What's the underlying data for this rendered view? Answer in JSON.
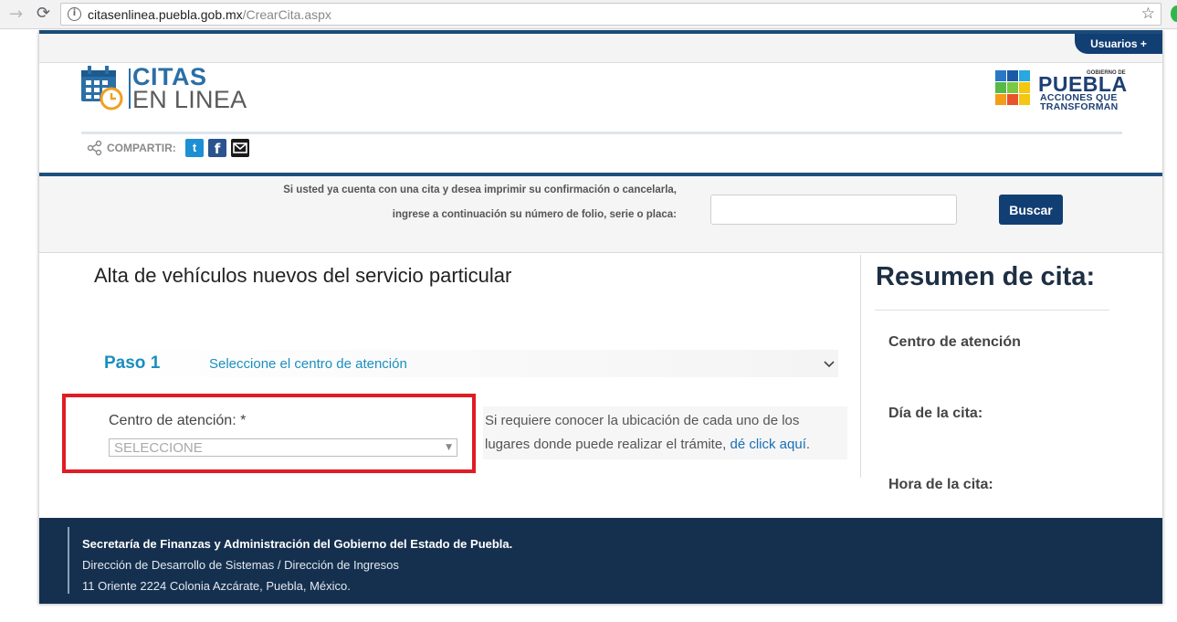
{
  "browser": {
    "url_host": "citasenlinea.puebla.gob.mx",
    "url_path": "/CrearCita.aspx",
    "forward_icon": "→",
    "reload_icon": "⟳",
    "star_icon": "☆"
  },
  "top": {
    "usuarios_label": "Usuarios +"
  },
  "header": {
    "logo_line1": "CITAS",
    "logo_line2": "EN LINEA",
    "puebla_small": "GOBIERNO DE",
    "puebla_word": "PUEBLA",
    "puebla_tag1": "ACCIONES QUE",
    "puebla_tag2": "TRANSFORMAN",
    "share_label": "COMPARTIR:",
    "twitter_glyph": "t",
    "facebook_glyph": "f"
  },
  "search": {
    "message_line1": "Si usted ya cuenta con una cita y desea imprimir su confirmación o cancelarla,",
    "message_line2": "ingrese a continuación su número de folio, serie o placa:",
    "input_value": "",
    "button_label": "Buscar"
  },
  "main": {
    "title": "Alta de vehículos nuevos del servicio particular",
    "step_label": "Paso 1",
    "step_text": "Seleccione el centro de atención",
    "centro_label": "Centro de atención: *",
    "centro_selected": "SELECCIONE",
    "select_arrow": "▼",
    "info_line1": "Si requiere conocer la ubicación de cada uno de los",
    "info_line2_prefix": "lugares donde puede realizar el trámite, ",
    "info_link": "dé click aquí",
    "info_line2_suffix": "."
  },
  "summary": {
    "title": "Resumen de cita:",
    "items": [
      "Centro de atención",
      "Día de la cita:",
      "Hora de la cita:"
    ]
  },
  "footer": {
    "line1": "Secretaría de Finanzas y Administración del Gobierno del Estado de Puebla.",
    "line2": "Dirección de Desarrollo de Sistemas / Dirección de Ingresos",
    "line3": "11 Oriente 2224 Colonia Azcárate, Puebla, México."
  },
  "colors": {
    "brand_dark": "#123f73",
    "accent": "#1a8fbe",
    "highlight_red": "#e01b24",
    "footer_bg": "#15304f"
  },
  "icons": [
    "info-icon",
    "star-icon",
    "calendar-icon",
    "clock-icon",
    "share-icon",
    "twitter-icon",
    "facebook-icon",
    "mail-icon",
    "chevron-down-icon"
  ]
}
